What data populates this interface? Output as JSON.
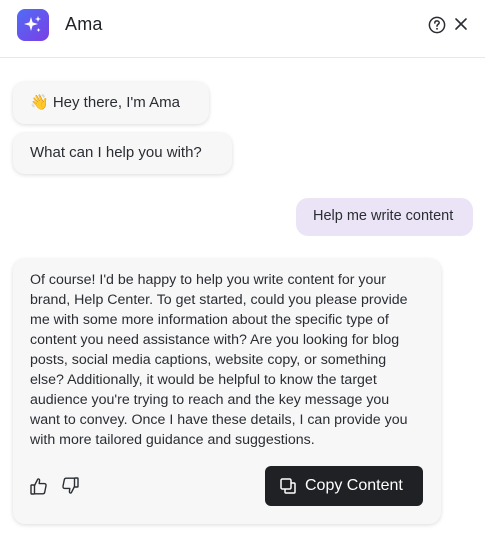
{
  "header": {
    "title": "Ama",
    "logo_icon": "sparkles-icon",
    "help_icon": "question-circle-icon",
    "close_icon": "close-icon",
    "logo_gradient": [
      "#4f6cf7",
      "#7b3fe4"
    ]
  },
  "messages": {
    "greeting": "👋 Hey there, I'm Ama",
    "prompt": "What can I help you with?",
    "user": "Help me write content",
    "reply": "Of course! I'd be happy to help you write content for your\nbrand, Help Center. To get started, could you please provide\nme with some more information about the specific type of\ncontent you need assistance with? Are you looking for blog\nposts, social media captions, website copy, or something\nelse? Additionally, it would be helpful to know the target\naudience you're trying to reach and the key message you\nwant to convey. Once I have these details, I can provide you\nwith more tailored guidance and suggestions."
  },
  "actions": {
    "thumbs_up_icon": "thumbs-up-icon",
    "thumbs_down_icon": "thumbs-down-icon",
    "copy_label": "Copy Content",
    "copy_icon": "copy-icon"
  },
  "colors": {
    "user_bubble": "#ebe4f6",
    "assistant_bubble": "#f7f7f8",
    "copy_button": "#202124"
  }
}
